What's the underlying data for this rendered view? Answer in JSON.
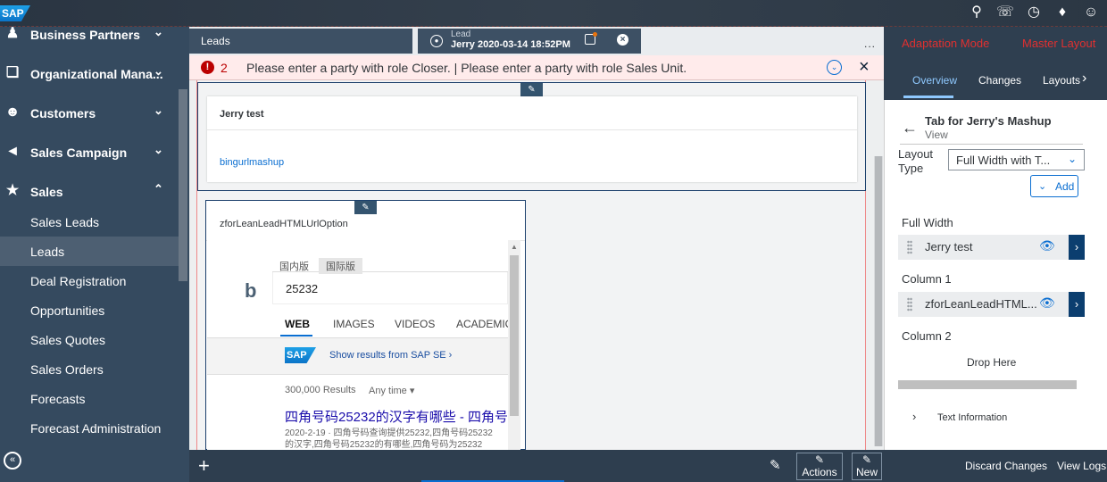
{
  "shell": {
    "logo": "SAP",
    "icons": [
      "search-icon",
      "headset-icon",
      "clock-icon",
      "bell-icon",
      "user-icon"
    ]
  },
  "sidebar": {
    "groups": [
      {
        "label": "Business Partners",
        "icon": "business-partners-icon",
        "expanded": false
      },
      {
        "label": "Organizational Mana...",
        "icon": "organization-icon",
        "expanded": false
      },
      {
        "label": "Customers",
        "icon": "customers-icon",
        "expanded": false
      },
      {
        "label": "Sales Campaign",
        "icon": "megaphone-icon",
        "expanded": false
      },
      {
        "label": "Sales",
        "icon": "sales-icon",
        "expanded": true
      }
    ],
    "sales_items": [
      "Sales Leads",
      "Leads",
      "Deal Registration",
      "Opportunities",
      "Sales Quotes",
      "Sales Orders",
      "Forecasts",
      "Forecast Administration"
    ],
    "active_item": "Leads"
  },
  "tabs": {
    "leads_label": "Leads",
    "lead_type": "Lead",
    "lead_title": "Jerry 2020-03-14 18:52PM",
    "overflow": "..."
  },
  "errors": {
    "count": "2",
    "message": "Please enter a party with role Closer. | Please enter a party with role Sales Unit."
  },
  "main": {
    "card1_title": "Jerry test",
    "card1_link": "bingurlmashup",
    "card2_title": "zforLeanLeadHTMLUrlOption"
  },
  "bing": {
    "tab_domestic": "国内版",
    "tab_international": "国际版",
    "query": "25232",
    "nav": [
      "WEB",
      "IMAGES",
      "VIDEOS",
      "ACADEMIC"
    ],
    "show_results": "Show results from SAP SE",
    "results_count": "300,000 Results",
    "any_time": "Any time",
    "result_title": "四角号码25232的汉字有哪些 - 四角号",
    "snippet1": "2020-2-19 · 四角号码查询提供25232,四角号码25232",
    "snippet2": "的汉字,四角号码25232的有哪些,四角号码为25232"
  },
  "footer": {
    "plus": "+",
    "actions_label": "Actions",
    "new_label": "New"
  },
  "panel": {
    "mode": "Adaptation Mode",
    "layout": "Master Layout",
    "tabs": [
      "Overview",
      "Changes",
      "Layouts"
    ],
    "active_tab": "Overview",
    "title": "Tab for Jerry's Mashup",
    "subtitle": "View",
    "layout_type_line1": "Layout",
    "layout_type_line2": "Type",
    "layout_value": "Full Width with T...",
    "add_label": "Add",
    "full_width_label": "Full Width",
    "full_width_item": "Jerry test",
    "column1_label": "Column 1",
    "column1_item": "zforLeanLeadHTML...",
    "column2_label": "Column 2",
    "drop_here": "Drop Here",
    "text_information": "Text Information",
    "discard": "Discard Changes",
    "view_logs": "View Logs"
  },
  "colors": {
    "shell": "#2a3542",
    "nav": "#354a5f",
    "accent": "#0a6ed1",
    "error": "#bb0000",
    "error_bg": "#ffebeb"
  }
}
